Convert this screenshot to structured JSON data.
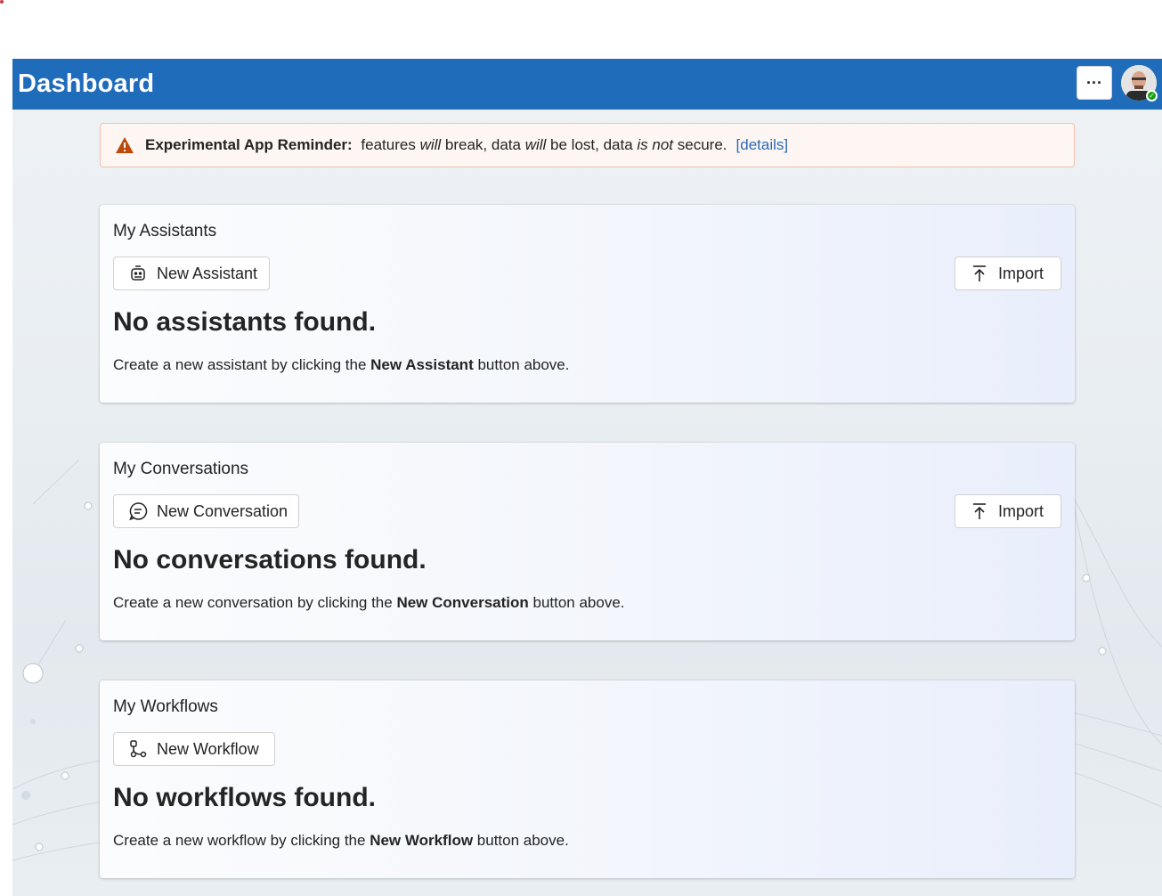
{
  "header": {
    "title": "Dashboard",
    "more_label": "···",
    "avatar_icon": "user-avatar",
    "presence_status": "available"
  },
  "banner": {
    "label": "Experimental App Reminder:",
    "t1": " features ",
    "e1": "will",
    "t2": " break, data ",
    "e2": "will",
    "t3": " be lost, data ",
    "e3": "is not",
    "t4": " secure.",
    "link": "[details]",
    "icon": "warning-icon"
  },
  "assistants": {
    "title": "My Assistants",
    "new_label": "New Assistant",
    "import_label": "Import",
    "empty_title": "No assistants found.",
    "empty_pre": "Create a new assistant by clicking the ",
    "empty_bold": "New Assistant",
    "empty_post": " button above."
  },
  "conversations": {
    "title": "My Conversations",
    "new_label": "New Conversation",
    "import_label": "Import",
    "empty_title": "No conversations found.",
    "empty_pre": "Create a new conversation by clicking the ",
    "empty_bold": "New Conversation",
    "empty_post": " button above."
  },
  "workflows": {
    "title": "My Workflows",
    "new_label": "New Workflow",
    "empty_title": "No workflows found.",
    "empty_pre": "Create a new workflow by clicking the ",
    "empty_bold": "New Workflow",
    "empty_post": " button above."
  },
  "colors": {
    "header_bg": "#1f6cbb",
    "banner_bg": "#fdf6f3",
    "banner_border": "#f4bfab",
    "warning": "#bc4b09",
    "link": "#2a6ab8"
  }
}
